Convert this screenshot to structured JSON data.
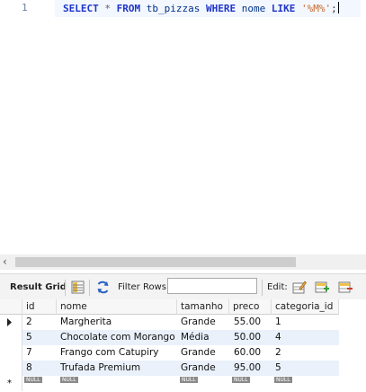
{
  "editor": {
    "line_number": "1",
    "sql": {
      "kw_select": "SELECT",
      "star": "*",
      "kw_from": "FROM",
      "table": "tb_pizzas",
      "kw_where": "WHERE",
      "column": "nome",
      "kw_like": "LIKE",
      "pattern": "'%M%'",
      "semicolon": ";"
    }
  },
  "toolbar": {
    "result_grid_label": "Result Grid",
    "filter_label": "Filter Rows:",
    "filter_value": "",
    "edit_label": "Edit:"
  },
  "grid": {
    "columns": [
      "id",
      "nome",
      "tamanho",
      "preco",
      "categoria_id"
    ],
    "rows": [
      [
        "2",
        "Margherita",
        "Grande",
        "55.00",
        "1"
      ],
      [
        "5",
        "Chocolate com Morango",
        "Média",
        "50.00",
        "4"
      ],
      [
        "7",
        "Frango com Catupiry",
        "Grande",
        "60.00",
        "2"
      ],
      [
        "8",
        "Trufada Premium",
        "Grande",
        "95.00",
        "5"
      ]
    ],
    "new_row_marker": "*",
    "null_label": "NULL"
  }
}
